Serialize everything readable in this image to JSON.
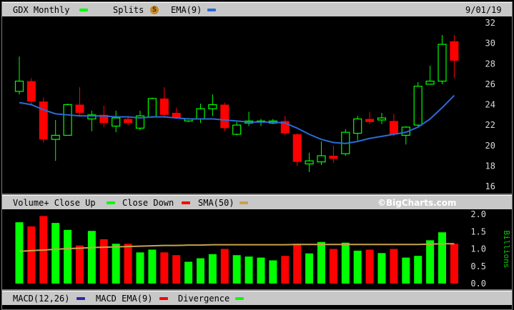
{
  "header": {
    "symbol_label": "GDX Monthly",
    "splits_label": "Splits",
    "splits_icon": "S",
    "ema_label": "EMA(9)",
    "date": "9/01/19"
  },
  "volume_header": {
    "label_volume": "Volume+ Close Up",
    "label_down": "Close Down",
    "label_sma": "SMA(50)",
    "watermark": "©BigCharts.com"
  },
  "macd_header": {
    "label_macd": "MACD(12,26)",
    "label_ema": "MACD EMA(9)",
    "label_div": "Divergence"
  },
  "colors": {
    "up": "#00ff00",
    "down": "#ff0000",
    "ema": "#2a6ad8",
    "sma": "#c8a24a",
    "header_bg": "#c8c8c8"
  },
  "chart_data": [
    {
      "type": "candlestick",
      "title": "GDX Monthly",
      "y_ticks": [
        "16",
        "18",
        "20",
        "22",
        "24",
        "26",
        "28",
        "30",
        "32"
      ],
      "ylim": [
        16,
        32
      ],
      "series": [
        {
          "o": 25.3,
          "h": 28.7,
          "l": 25.0,
          "c": 26.3
        },
        {
          "o": 26.3,
          "h": 26.6,
          "l": 23.9,
          "c": 24.3
        },
        {
          "o": 24.3,
          "h": 24.7,
          "l": 20.3,
          "c": 20.6
        },
        {
          "o": 20.6,
          "h": 22.5,
          "l": 18.5,
          "c": 21.0
        },
        {
          "o": 21.0,
          "h": 24.1,
          "l": 21.0,
          "c": 24.0
        },
        {
          "o": 24.0,
          "h": 25.7,
          "l": 22.8,
          "c": 23.2
        },
        {
          "o": 22.6,
          "h": 23.4,
          "l": 21.4,
          "c": 23.0
        },
        {
          "o": 23.0,
          "h": 23.9,
          "l": 21.8,
          "c": 22.2
        },
        {
          "o": 21.9,
          "h": 23.4,
          "l": 21.3,
          "c": 22.7
        },
        {
          "o": 22.6,
          "h": 22.9,
          "l": 22.0,
          "c": 22.2
        },
        {
          "o": 21.7,
          "h": 23.4,
          "l": 21.5,
          "c": 22.9
        },
        {
          "o": 22.8,
          "h": 24.7,
          "l": 22.7,
          "c": 24.6
        },
        {
          "o": 24.6,
          "h": 25.7,
          "l": 22.8,
          "c": 23.0
        },
        {
          "o": 23.2,
          "h": 23.7,
          "l": 22.6,
          "c": 22.7
        },
        {
          "o": 22.4,
          "h": 22.7,
          "l": 22.3,
          "c": 22.6
        },
        {
          "o": 22.6,
          "h": 24.1,
          "l": 22.2,
          "c": 23.6
        },
        {
          "o": 23.6,
          "h": 25.0,
          "l": 22.9,
          "c": 24.0
        },
        {
          "o": 24.0,
          "h": 24.2,
          "l": 21.4,
          "c": 21.7
        },
        {
          "o": 21.1,
          "h": 22.3,
          "l": 21.0,
          "c": 22.0
        },
        {
          "o": 22.2,
          "h": 23.3,
          "l": 21.9,
          "c": 22.4
        },
        {
          "o": 22.3,
          "h": 22.6,
          "l": 21.9,
          "c": 22.4
        },
        {
          "o": 22.2,
          "h": 22.6,
          "l": 22.1,
          "c": 22.4
        },
        {
          "o": 22.4,
          "h": 22.9,
          "l": 21.0,
          "c": 21.2
        },
        {
          "o": 21.1,
          "h": 21.2,
          "l": 18.0,
          "c": 18.4
        },
        {
          "o": 18.2,
          "h": 19.3,
          "l": 17.4,
          "c": 18.5
        },
        {
          "o": 18.4,
          "h": 20.4,
          "l": 18.1,
          "c": 19.0
        },
        {
          "o": 19.0,
          "h": 20.0,
          "l": 18.3,
          "c": 18.7
        },
        {
          "o": 19.2,
          "h": 21.6,
          "l": 19.0,
          "c": 21.3
        },
        {
          "o": 21.2,
          "h": 22.9,
          "l": 20.5,
          "c": 22.6
        },
        {
          "o": 22.6,
          "h": 23.3,
          "l": 22.1,
          "c": 22.3
        },
        {
          "o": 22.5,
          "h": 23.2,
          "l": 22.1,
          "c": 22.7
        },
        {
          "o": 22.4,
          "h": 23.1,
          "l": 20.9,
          "c": 21.1
        },
        {
          "o": 21.0,
          "h": 21.9,
          "l": 20.1,
          "c": 21.8
        },
        {
          "o": 22.0,
          "h": 26.2,
          "l": 21.9,
          "c": 25.8
        },
        {
          "o": 26.0,
          "h": 27.8,
          "l": 26.0,
          "c": 26.3
        },
        {
          "o": 26.3,
          "h": 30.8,
          "l": 26.0,
          "c": 29.9
        },
        {
          "o": 30.2,
          "h": 30.8,
          "l": 26.6,
          "c": 28.3
        }
      ],
      "ema": [
        24.2,
        24.0,
        23.5,
        23.1,
        23.0,
        22.9,
        22.9,
        22.9,
        22.8,
        22.8,
        22.7,
        22.8,
        22.8,
        22.7,
        22.6,
        22.6,
        22.6,
        22.5,
        22.4,
        22.3,
        22.3,
        22.3,
        22.2,
        21.7,
        21.1,
        20.6,
        20.3,
        20.2,
        20.4,
        20.7,
        20.9,
        21.1,
        21.3,
        21.8,
        22.6,
        23.7,
        24.9
      ]
    },
    {
      "type": "bar",
      "title": "Volume",
      "ylabel": "Billions",
      "y_ticks": [
        "0.0",
        "0.5",
        "1.0",
        "1.5",
        "2.0"
      ],
      "ylim": [
        0,
        2.0
      ],
      "values": [
        1.77,
        1.65,
        1.95,
        1.75,
        1.55,
        1.1,
        1.52,
        1.28,
        1.15,
        1.15,
        0.9,
        0.98,
        0.9,
        0.82,
        0.63,
        0.73,
        0.85,
        1.0,
        0.82,
        0.78,
        0.75,
        0.67,
        0.8,
        1.15,
        0.87,
        1.2,
        1.0,
        1.18,
        0.95,
        0.98,
        0.88,
        1.0,
        0.75,
        0.8,
        1.25,
        1.48,
        1.15
      ],
      "sma": [
        0.93,
        0.95,
        0.97,
        0.99,
        1.01,
        1.02,
        1.04,
        1.05,
        1.06,
        1.07,
        1.08,
        1.09,
        1.1,
        1.1,
        1.11,
        1.11,
        1.12,
        1.12,
        1.12,
        1.12,
        1.12,
        1.12,
        1.12,
        1.13,
        1.13,
        1.13,
        1.13,
        1.13,
        1.13,
        1.13,
        1.13,
        1.13,
        1.13,
        1.13,
        1.14,
        1.15,
        1.15
      ]
    }
  ]
}
